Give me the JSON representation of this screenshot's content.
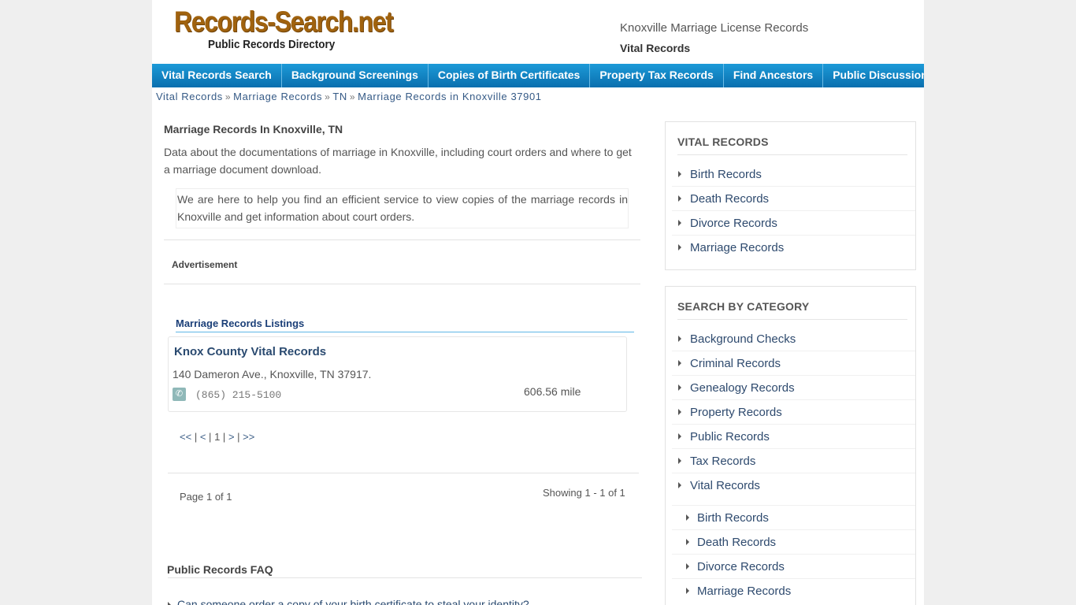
{
  "header": {
    "logo_main": "Records-Search.net",
    "logo_sub": "Public Records Directory",
    "title": "Knoxville Marriage License Records",
    "subtitle": "Vital Records"
  },
  "nav": {
    "items": [
      {
        "label": "Vital Records Search"
      },
      {
        "label": "Background Screenings"
      },
      {
        "label": "Copies of Birth Certificates"
      },
      {
        "label": "Property Tax Records"
      },
      {
        "label": "Find Ancestors"
      },
      {
        "label": "Public Discussion"
      }
    ]
  },
  "breadcrumb": {
    "items": [
      "Vital Records",
      "Marriage Records",
      "TN",
      "Marriage Records in Knoxville 37901"
    ],
    "separator": "»"
  },
  "main": {
    "heading": "Marriage Records In Knoxville, TN",
    "intro": "Data about the documentations of marriage in Knoxville, including court orders and where to get a marriage document download.",
    "help_text": "We are here to help you find an efficient service to view copies of the marriage records in Knoxville and get information about court orders.",
    "advertisement_label": "Advertisement",
    "listings_title": "Marriage Records Listings",
    "listing": {
      "name": "Knox County Vital Records",
      "address": "140 Dameron Ave., Knoxville, TN 37917.",
      "phone": "(865) 215-5100",
      "distance": "606.56 mile"
    },
    "pager": {
      "first": "<<",
      "prev": "<",
      "current": "1",
      "next": ">",
      "last": ">>",
      "sep": "|"
    },
    "page_of": "Page 1 of 1",
    "showing": "Showing 1 - 1 of 1",
    "faq_title": "Public Records FAQ",
    "faq_first": "Can someone order a copy of your birth certificate to steal your identity?"
  },
  "sidebar": {
    "vital": {
      "title": "VITAL RECORDS",
      "items": [
        "Birth Records",
        "Death Records",
        "Divorce Records",
        "Marriage Records"
      ]
    },
    "category": {
      "title": "SEARCH BY CATEGORY",
      "items": [
        "Background Checks",
        "Criminal Records",
        "Genealogy Records",
        "Property Records",
        "Public Records",
        "Tax Records",
        "Vital Records"
      ],
      "sub_items": [
        "Birth Records",
        "Death Records",
        "Divorce Records",
        "Marriage Records"
      ]
    }
  },
  "colors": {
    "nav_bg": "#0f84c7",
    "link": "#2e4a6e",
    "logo": "#a0620e"
  }
}
